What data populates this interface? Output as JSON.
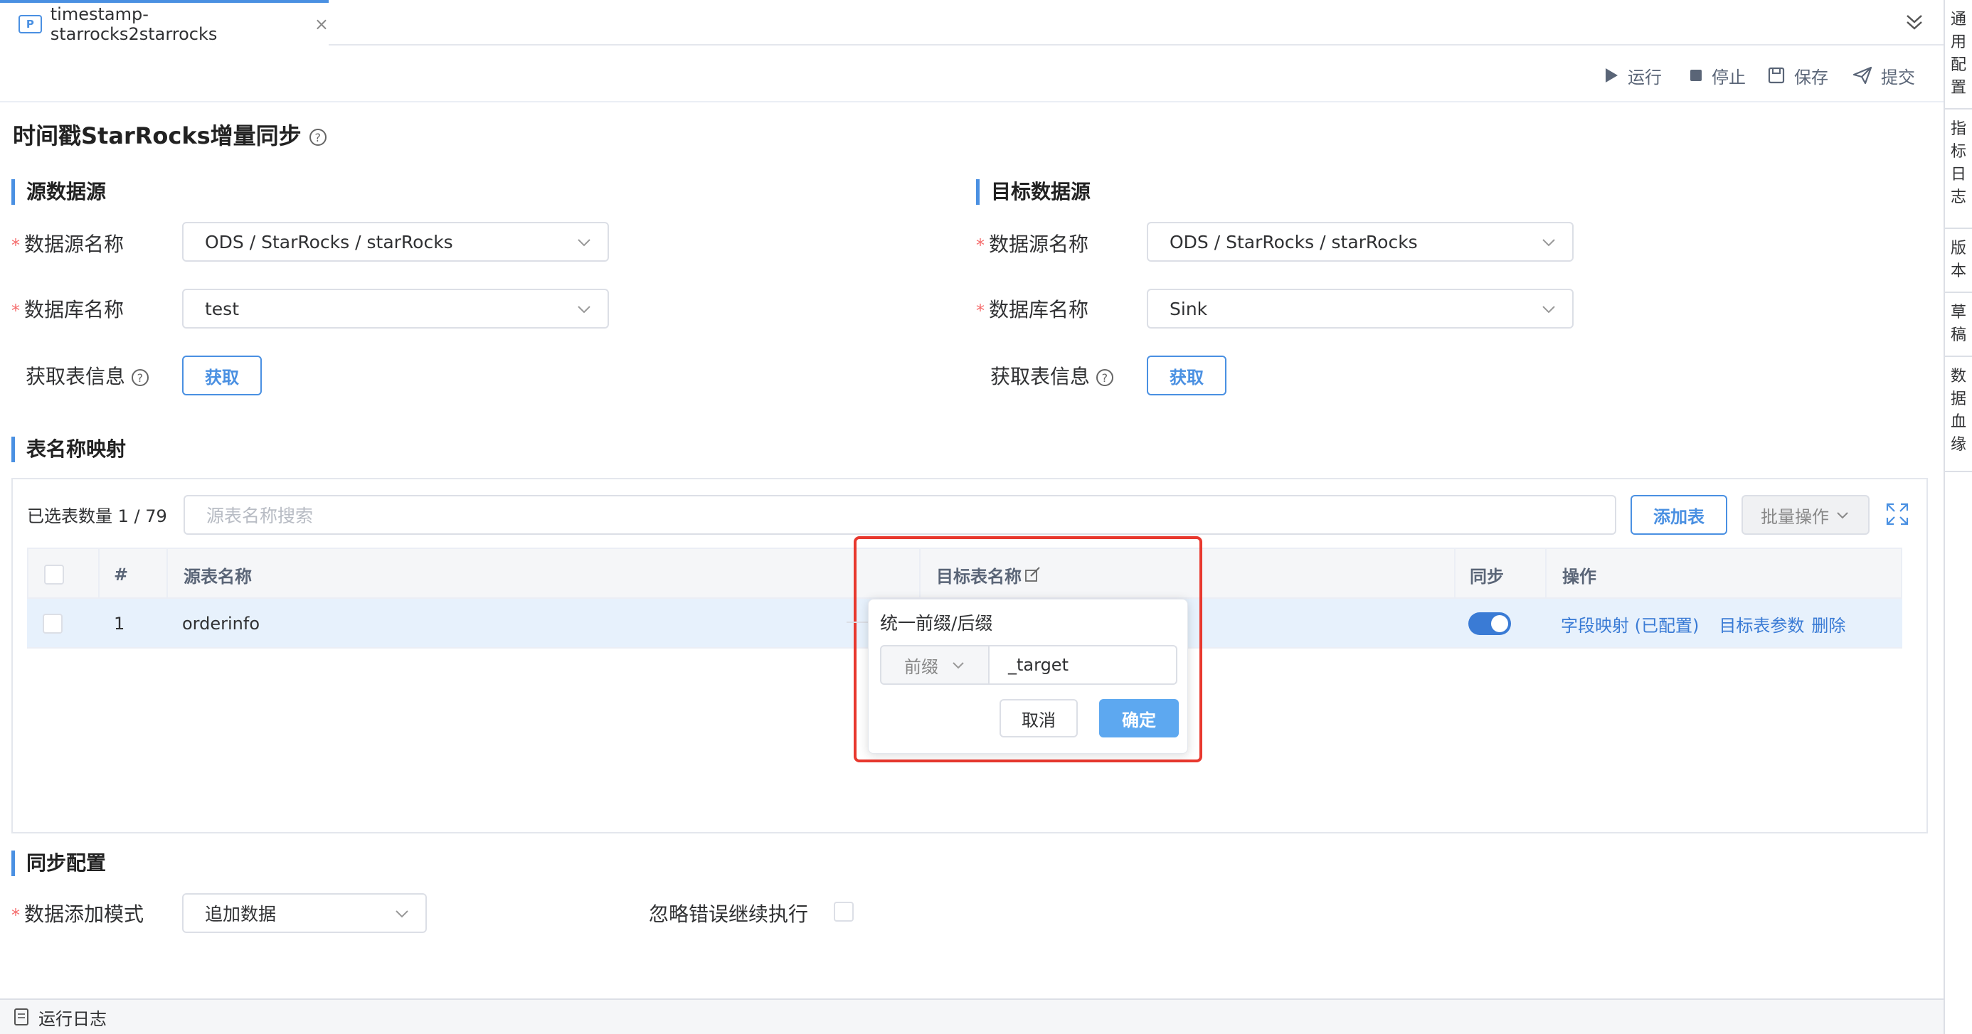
{
  "tab": {
    "label": "timestamp-starrocks2starrocks",
    "close": "×"
  },
  "toolbar": {
    "run": "运行",
    "stop": "停止",
    "save": "保存",
    "submit": "提交"
  },
  "rail": [
    "通用配置",
    "指标日志",
    "版本",
    "草稿",
    "数据血缘"
  ],
  "page": {
    "title": "时间戳StarRocks增量同步",
    "help": "?"
  },
  "source": {
    "title": "源数据源",
    "datasource_label": "数据源名称",
    "datasource_value": "ODS / StarRocks / starRocks",
    "database_label": "数据库名称",
    "database_value": "test",
    "fetch_label": "获取表信息",
    "fetch_button": "获取"
  },
  "target": {
    "title": "目标数据源",
    "datasource_label": "数据源名称",
    "datasource_value": "ODS / StarRocks / starRocks",
    "database_label": "数据库名称",
    "database_value": "Sink",
    "fetch_label": "获取表信息",
    "fetch_button": "获取"
  },
  "mapping": {
    "title": "表名称映射",
    "selected_count": "已选表数量 1 / 79",
    "search_placeholder": "源表名称搜索",
    "add_table": "添加表",
    "batch_ops": "批量操作",
    "columns": {
      "index": "#",
      "source": "源表名称",
      "target": "目标表名称",
      "sync": "同步",
      "ops": "操作"
    },
    "rows": [
      {
        "index": "1",
        "source": "orderinfo",
        "sync": true,
        "field_map": "字段映射 (已配置)",
        "target_params": "目标表参数",
        "delete": "删除"
      }
    ]
  },
  "popover": {
    "title": "统一前缀/后缀",
    "mode": "前缀",
    "value": "_target",
    "cancel": "取消",
    "confirm": "确定"
  },
  "sync_config": {
    "title": "同步配置",
    "mode_label": "数据添加模式",
    "mode_value": "追加数据",
    "ignore_label": "忽略错误继续执行"
  },
  "bottom": {
    "log_label": "运行日志"
  },
  "colors": {
    "accent": "#4a90e2",
    "highlight": "#e8382e",
    "required": "#f56c6c"
  }
}
